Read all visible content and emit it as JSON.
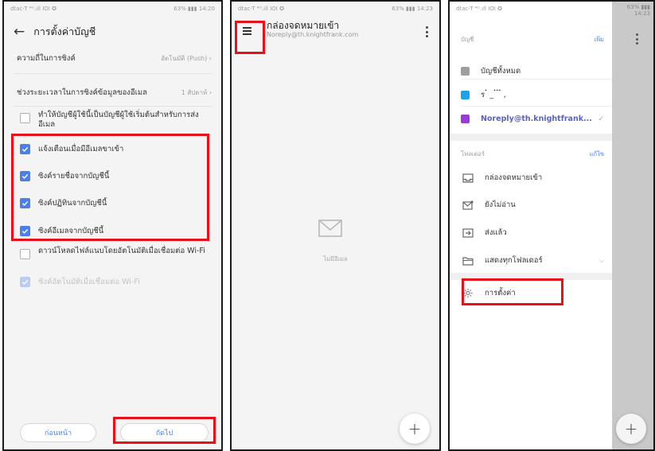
{
  "colors": {
    "accent": "#4a7ff0",
    "annotation": "#e8101a",
    "account_colors": [
      "#9e9e9e",
      "#1da1e8",
      "#9b3bd6"
    ]
  },
  "screen1": {
    "status_left": "dtac-T ⁴ᴳ.ıll IOI ✪",
    "status_right": "63% ▮▮▮ 14:20",
    "title": "การตั้งค่าบัญชี",
    "rows": [
      {
        "label": "ความถี่ในการซิงค์",
        "value": "อัตโนมัติ (Push) ›"
      },
      {
        "label": "ช่วงระยะเวลาในการซิงค์ข้อมูลของอีเมล",
        "value": "1 สัปดาห์ ›"
      }
    ],
    "checks": [
      {
        "label": "ทำให้บัญชีผู้ใช้นี้เป็นบัญชีผู้ใช้เริ่มต้นสำหรับการส่งอีเมล",
        "state": "off"
      },
      {
        "label": "แจ้งเตือนเมื่อมีอีเมลขาเข้า",
        "state": "on"
      },
      {
        "label": "ซิงค์รายชื่อจากบัญชีนี้",
        "state": "on"
      },
      {
        "label": "ซิงค์ปฏิทินจากบัญชีนี้",
        "state": "on"
      },
      {
        "label": "ซิงค์อีเมลจากบัญชีนี้",
        "state": "on"
      },
      {
        "label": "ดาวน์โหลดไฟล์แนบโดยอัตโนมัติเมื่อเชื่อมต่อ Wi-Fi",
        "state": "off"
      },
      {
        "label": "ซิงค์อัตโนมัติเมื่อเชื่อมต่อ Wi-Fi",
        "state": "disabled"
      }
    ],
    "prev_button": "ก่อนหน้า",
    "next_button": "ถัดไป"
  },
  "screen2": {
    "status_left": "dtac-T ⁴ᴳ.ıll IOI ✪",
    "status_right": "63% ▮▮▮ 14:23",
    "title": "กล่องจดหมายเข้า",
    "subtitle": "Noreply@th.knightfrank.com",
    "empty_text": "ไม่มีอีเมล",
    "fab": "+",
    "icons": {
      "menu": "hamburger-menu-icon",
      "more": "more-vertical-icon",
      "empty": "envelope-icon"
    }
  },
  "screen3": {
    "status_left": "dtac-T ⁴ᴳ.ıll IOI ✪",
    "status_right": "63% ▮▮▮ 14:23",
    "accounts_header": "บัญชี",
    "accounts_action": "เพิ่ม",
    "accounts": [
      {
        "label": "บัญชีทั้งหมด"
      },
      {
        "label": "ร ๋ _ ๋ ๋ ๋ ,"
      },
      {
        "label": "Noreply@th.knightfrank...",
        "check": "✓"
      }
    ],
    "folders_header": "โฟลเดอร์",
    "folders_action": "แก้ไข",
    "folders": [
      {
        "label": "กล่องจดหมายเข้า",
        "icon": "inbox-icon"
      },
      {
        "label": "ยังไม่อ่าน",
        "icon": "unread-mail-icon"
      },
      {
        "label": "ส่งแล้ว",
        "icon": "sent-icon"
      },
      {
        "label": "แสดงทุกโฟลเดอร์",
        "icon": "folder-icon",
        "chevron": "⌵"
      }
    ],
    "settings_label": "การตั้งค่า",
    "settings_icon": "gear-icon",
    "fab": "+"
  }
}
